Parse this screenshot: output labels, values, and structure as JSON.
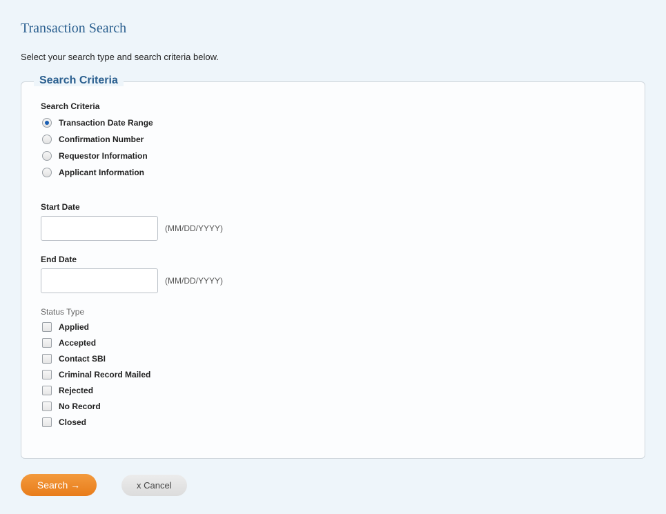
{
  "page_title": "Transaction Search",
  "subtitle": "Select your search type and search criteria below.",
  "fieldset": {
    "legend": "Search Criteria",
    "search_type_label": "Search Criteria",
    "radios": [
      {
        "label": "Transaction Date Range",
        "checked": true
      },
      {
        "label": "Confirmation Number",
        "checked": false
      },
      {
        "label": "Requestor Information",
        "checked": false
      },
      {
        "label": "Applicant Information",
        "checked": false
      }
    ],
    "start_date": {
      "label": "Start Date",
      "value": "",
      "hint": "(MM/DD/YYYY)"
    },
    "end_date": {
      "label": "End Date",
      "value": "",
      "hint": "(MM/DD/YYYY)"
    },
    "status": {
      "label": "Status Type",
      "options": [
        {
          "label": "Applied",
          "checked": false
        },
        {
          "label": "Accepted",
          "checked": false
        },
        {
          "label": "Contact SBI",
          "checked": false
        },
        {
          "label": "Criminal Record Mailed",
          "checked": false
        },
        {
          "label": "Rejected",
          "checked": false
        },
        {
          "label": "No Record",
          "checked": false
        },
        {
          "label": "Closed",
          "checked": false
        }
      ]
    }
  },
  "buttons": {
    "search": "Search →",
    "cancel": "x Cancel"
  }
}
